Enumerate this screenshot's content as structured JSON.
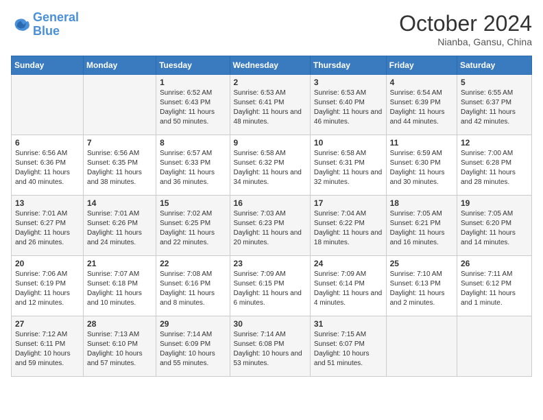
{
  "logo": {
    "line1": "General",
    "line2": "Blue"
  },
  "title": "October 2024",
  "subtitle": "Nianba, Gansu, China",
  "days_header": [
    "Sunday",
    "Monday",
    "Tuesday",
    "Wednesday",
    "Thursday",
    "Friday",
    "Saturday"
  ],
  "weeks": [
    [
      {
        "day": "",
        "info": ""
      },
      {
        "day": "",
        "info": ""
      },
      {
        "day": "1",
        "info": "Sunrise: 6:52 AM\nSunset: 6:43 PM\nDaylight: 11 hours and 50 minutes."
      },
      {
        "day": "2",
        "info": "Sunrise: 6:53 AM\nSunset: 6:41 PM\nDaylight: 11 hours and 48 minutes."
      },
      {
        "day": "3",
        "info": "Sunrise: 6:53 AM\nSunset: 6:40 PM\nDaylight: 11 hours and 46 minutes."
      },
      {
        "day": "4",
        "info": "Sunrise: 6:54 AM\nSunset: 6:39 PM\nDaylight: 11 hours and 44 minutes."
      },
      {
        "day": "5",
        "info": "Sunrise: 6:55 AM\nSunset: 6:37 PM\nDaylight: 11 hours and 42 minutes."
      }
    ],
    [
      {
        "day": "6",
        "info": "Sunrise: 6:56 AM\nSunset: 6:36 PM\nDaylight: 11 hours and 40 minutes."
      },
      {
        "day": "7",
        "info": "Sunrise: 6:56 AM\nSunset: 6:35 PM\nDaylight: 11 hours and 38 minutes."
      },
      {
        "day": "8",
        "info": "Sunrise: 6:57 AM\nSunset: 6:33 PM\nDaylight: 11 hours and 36 minutes."
      },
      {
        "day": "9",
        "info": "Sunrise: 6:58 AM\nSunset: 6:32 PM\nDaylight: 11 hours and 34 minutes."
      },
      {
        "day": "10",
        "info": "Sunrise: 6:58 AM\nSunset: 6:31 PM\nDaylight: 11 hours and 32 minutes."
      },
      {
        "day": "11",
        "info": "Sunrise: 6:59 AM\nSunset: 6:30 PM\nDaylight: 11 hours and 30 minutes."
      },
      {
        "day": "12",
        "info": "Sunrise: 7:00 AM\nSunset: 6:28 PM\nDaylight: 11 hours and 28 minutes."
      }
    ],
    [
      {
        "day": "13",
        "info": "Sunrise: 7:01 AM\nSunset: 6:27 PM\nDaylight: 11 hours and 26 minutes."
      },
      {
        "day": "14",
        "info": "Sunrise: 7:01 AM\nSunset: 6:26 PM\nDaylight: 11 hours and 24 minutes."
      },
      {
        "day": "15",
        "info": "Sunrise: 7:02 AM\nSunset: 6:25 PM\nDaylight: 11 hours and 22 minutes."
      },
      {
        "day": "16",
        "info": "Sunrise: 7:03 AM\nSunset: 6:23 PM\nDaylight: 11 hours and 20 minutes."
      },
      {
        "day": "17",
        "info": "Sunrise: 7:04 AM\nSunset: 6:22 PM\nDaylight: 11 hours and 18 minutes."
      },
      {
        "day": "18",
        "info": "Sunrise: 7:05 AM\nSunset: 6:21 PM\nDaylight: 11 hours and 16 minutes."
      },
      {
        "day": "19",
        "info": "Sunrise: 7:05 AM\nSunset: 6:20 PM\nDaylight: 11 hours and 14 minutes."
      }
    ],
    [
      {
        "day": "20",
        "info": "Sunrise: 7:06 AM\nSunset: 6:19 PM\nDaylight: 11 hours and 12 minutes."
      },
      {
        "day": "21",
        "info": "Sunrise: 7:07 AM\nSunset: 6:18 PM\nDaylight: 11 hours and 10 minutes."
      },
      {
        "day": "22",
        "info": "Sunrise: 7:08 AM\nSunset: 6:16 PM\nDaylight: 11 hours and 8 minutes."
      },
      {
        "day": "23",
        "info": "Sunrise: 7:09 AM\nSunset: 6:15 PM\nDaylight: 11 hours and 6 minutes."
      },
      {
        "day": "24",
        "info": "Sunrise: 7:09 AM\nSunset: 6:14 PM\nDaylight: 11 hours and 4 minutes."
      },
      {
        "day": "25",
        "info": "Sunrise: 7:10 AM\nSunset: 6:13 PM\nDaylight: 11 hours and 2 minutes."
      },
      {
        "day": "26",
        "info": "Sunrise: 7:11 AM\nSunset: 6:12 PM\nDaylight: 11 hours and 1 minute."
      }
    ],
    [
      {
        "day": "27",
        "info": "Sunrise: 7:12 AM\nSunset: 6:11 PM\nDaylight: 10 hours and 59 minutes."
      },
      {
        "day": "28",
        "info": "Sunrise: 7:13 AM\nSunset: 6:10 PM\nDaylight: 10 hours and 57 minutes."
      },
      {
        "day": "29",
        "info": "Sunrise: 7:14 AM\nSunset: 6:09 PM\nDaylight: 10 hours and 55 minutes."
      },
      {
        "day": "30",
        "info": "Sunrise: 7:14 AM\nSunset: 6:08 PM\nDaylight: 10 hours and 53 minutes."
      },
      {
        "day": "31",
        "info": "Sunrise: 7:15 AM\nSunset: 6:07 PM\nDaylight: 10 hours and 51 minutes."
      },
      {
        "day": "",
        "info": ""
      },
      {
        "day": "",
        "info": ""
      }
    ]
  ]
}
